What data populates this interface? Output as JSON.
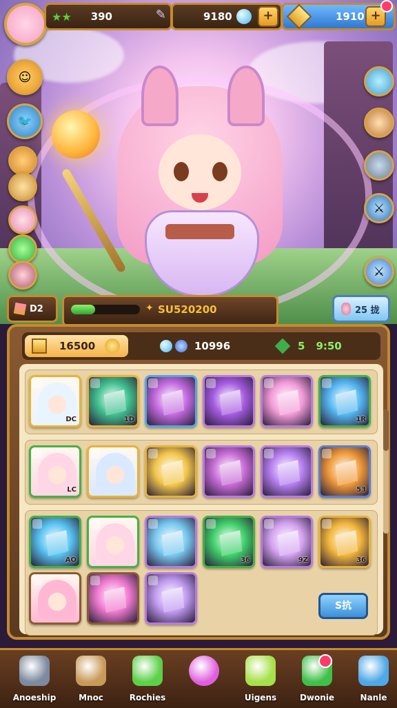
{
  "top_bar": {
    "level_value": "390",
    "gems_value": "9180",
    "coins_value": "1910"
  },
  "mid_bar": {
    "left_label": "D2",
    "center_value": "SU520200",
    "progress": 0.35,
    "right_label": "25 拢"
  },
  "resources": {
    "gold_value": "16500",
    "crystal_value": "10996",
    "green_value": "5",
    "timer": "9:50"
  },
  "rows": [
    [
      {
        "label": "DC",
        "kind": "portrait",
        "color": "#e8f4ff",
        "frame": "#e5b33b"
      },
      {
        "label": "1D",
        "kind": "shard",
        "color": "#3fbf8f",
        "frame": "#e5b33b"
      },
      {
        "label": "",
        "kind": "shard",
        "color": "#c36be0",
        "frame": "#4fa8e8"
      },
      {
        "label": "",
        "kind": "shard",
        "color": "#a55be0",
        "frame": "#b97be0"
      },
      {
        "label": "",
        "kind": "shard",
        "color": "#f29bd8",
        "frame": "#b97be0"
      },
      {
        "label": "1R",
        "kind": "shard",
        "color": "#53b6f0",
        "frame": "#46b045"
      }
    ],
    [
      {
        "label": "LC",
        "kind": "portrait",
        "color": "#ffd6e6",
        "frame": "#46b045"
      },
      {
        "label": "",
        "kind": "portrait",
        "color": "#d9e9ff",
        "frame": "#e5b33b"
      },
      {
        "label": "",
        "kind": "shard",
        "color": "#f2c54a",
        "frame": "#e5b33b"
      },
      {
        "label": "",
        "kind": "shard",
        "color": "#c76bd6",
        "frame": "#b97be0"
      },
      {
        "label": "",
        "kind": "shard",
        "color": "#b67ff0",
        "frame": "#b97be0"
      },
      {
        "label": "53",
        "kind": "shard",
        "color": "#f09a3a",
        "frame": "#5b7fd0"
      }
    ],
    [
      {
        "label": "AO",
        "kind": "shard",
        "color": "#56c2f0",
        "frame": "#46b045"
      },
      {
        "label": "",
        "kind": "portrait",
        "color": "#ffd6e6",
        "frame": "#46b045"
      },
      {
        "label": "",
        "kind": "shard",
        "color": "#78c8f0",
        "frame": "#b97be0"
      },
      {
        "label": "36",
        "kind": "shard",
        "color": "#3fd06a",
        "frame": "#46b045"
      },
      {
        "label": "9Z",
        "kind": "shard",
        "color": "#d3a2f0",
        "frame": "#b97be0"
      },
      {
        "label": "36",
        "kind": "shard",
        "color": "#f2b53a",
        "frame": "#e5b33b"
      }
    ],
    [
      {
        "label": "",
        "kind": "portrait",
        "color": "#ffb7d4",
        "frame": "#8a5a32"
      },
      {
        "label": "",
        "kind": "shard",
        "color": "#f07ad0",
        "frame": "#8a5a32"
      },
      {
        "label": "",
        "kind": "shard",
        "color": "#c09af0",
        "frame": "#b97be0"
      }
    ]
  ],
  "action_button_label": "S抗",
  "nav": [
    {
      "label": "Anoeship",
      "icon": "cat-icon",
      "color": "#7d8aa0"
    },
    {
      "label": "Mnoc",
      "icon": "cube-icon",
      "color": "#c89a5a"
    },
    {
      "label": "Rochies",
      "icon": "leaf-crystal-icon",
      "color": "#5dd04a"
    },
    {
      "label": "",
      "icon": "heart-icon",
      "color": "#e05fe0"
    },
    {
      "label": "Uigens",
      "icon": "gem-box-icon",
      "color": "#a6e04a"
    },
    {
      "label": "Dwonie",
      "icon": "chat-bubble-icon",
      "color": "#3fc04a"
    },
    {
      "label": "Nanle",
      "icon": "card-icon",
      "color": "#4fa8e8"
    }
  ]
}
